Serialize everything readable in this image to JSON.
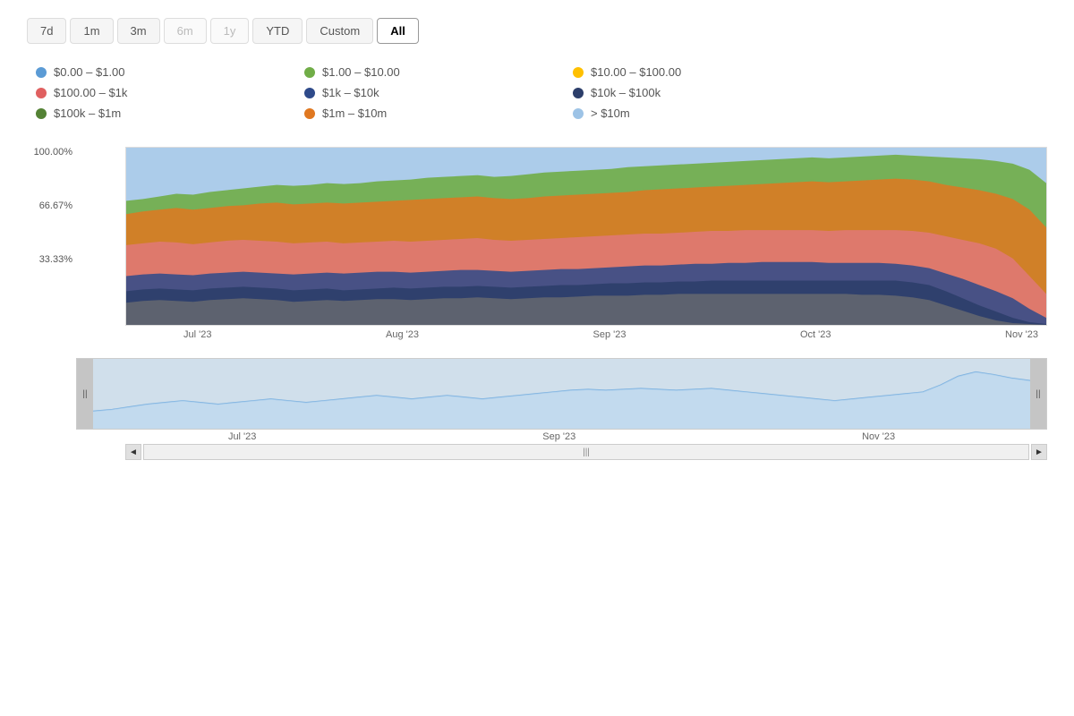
{
  "timeRange": {
    "buttons": [
      {
        "label": "7d",
        "state": "normal"
      },
      {
        "label": "1m",
        "state": "normal"
      },
      {
        "label": "3m",
        "state": "normal"
      },
      {
        "label": "6m",
        "state": "disabled"
      },
      {
        "label": "1y",
        "state": "disabled"
      },
      {
        "label": "YTD",
        "state": "normal"
      },
      {
        "label": "Custom",
        "state": "normal"
      },
      {
        "label": "All",
        "state": "active"
      }
    ]
  },
  "legend": {
    "items": [
      {
        "label": "$0.00 – $1.00",
        "color": "#5b9bd5"
      },
      {
        "label": "$1.00 – $10.00",
        "color": "#70ad47"
      },
      {
        "label": "$10.00 – $100.00",
        "color": "#ffc000"
      },
      {
        "label": "$100.00 – $1k",
        "color": "#e06060"
      },
      {
        "label": "$1k – $10k",
        "color": "#2e4a8a"
      },
      {
        "label": "$10k – $100k",
        "color": "#2c3e6a"
      },
      {
        "label": "$100k – $1m",
        "color": "#548235"
      },
      {
        "label": "$1m – $10m",
        "color": "#e07820"
      },
      {
        "label": "> $10m",
        "color": "#9dc3e6"
      }
    ]
  },
  "yAxis": {
    "labels": [
      "100.00%",
      "66.67%",
      "33.33%",
      ""
    ]
  },
  "xAxis": {
    "labels": [
      "Jul '23",
      "Aug '23",
      "Sep '23",
      "Oct '23",
      "Nov '23"
    ]
  },
  "miniChart": {
    "xLabels": [
      "Jul '23",
      "Sep '23",
      "Nov '23"
    ]
  },
  "scrollbar": {
    "leftArrow": "◄",
    "rightArrow": "►",
    "centerIcon": "|||"
  }
}
